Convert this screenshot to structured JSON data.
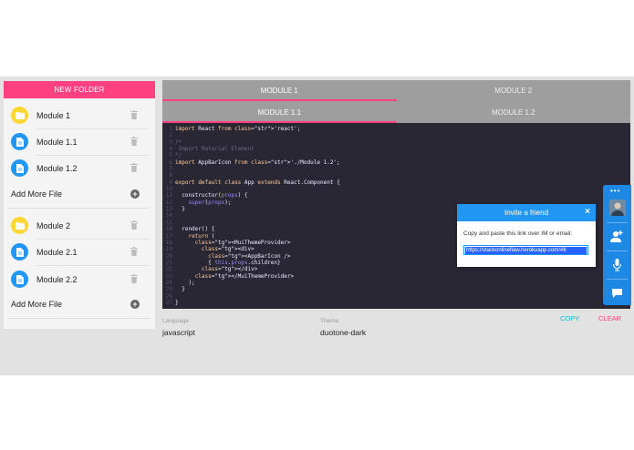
{
  "sidebar": {
    "new_folder_label": "NEW FOLDER",
    "groups": [
      {
        "folder": "Module 1",
        "files": [
          "Module 1.1",
          "Module 1.2"
        ],
        "add_label": "Add More File"
      },
      {
        "folder": "Module 2",
        "files": [
          "Module 2.1",
          "Module 2.2"
        ],
        "add_label": "Add More File"
      }
    ]
  },
  "tabs": {
    "modules": [
      "MODULE 1",
      "MODULE 2"
    ],
    "files": [
      "MODULE 1.1",
      "MODULE 1.2"
    ]
  },
  "editor": {
    "line_numbers": [
      "1",
      "2",
      "3",
      "4",
      "5",
      "6",
      "7",
      "8",
      "9",
      "10",
      "11",
      "12",
      "13",
      "14",
      "15",
      "16",
      "17",
      "18",
      "19",
      "20",
      "21",
      "22",
      "23",
      "24",
      "25",
      "26",
      "27"
    ],
    "lines": [
      "import React from 'react';",
      "",
      "/*",
      " Import Material Element",
      "*/",
      "import AppBarIcon from './Module 1.2';",
      "",
      "",
      "export default class App extends React.Component {",
      "",
      "  constructor(props) {",
      "    super(props);",
      "  }",
      "",
      "",
      "  render() {",
      "    return (",
      "      <MuiThemeProvider>",
      "        <div>",
      "          <AppBarIcon />",
      "          { this.props.children}",
      "        </div>",
      "      </MuiThemeProvider>",
      "    );",
      "  }",
      "",
      "}"
    ]
  },
  "footer": {
    "language_label": "Language",
    "language_value": "javascript",
    "theme_label": "Theme",
    "theme_value": "duotone-dark",
    "copy_label": "COPY",
    "clear_label": "CLEAR"
  },
  "invite": {
    "title": "Invite a friend",
    "close": "×",
    "text": "Copy and paste this link over IM or email:",
    "link": "https://stackonlineflaw.herokuapp.com/#6"
  },
  "widget": {
    "dots": "•••"
  },
  "colors": {
    "accent": "#ff4081",
    "primary": "#2196f3",
    "editor_bg": "#2a2734",
    "tab_bg": "#9e9e9e",
    "folder": "#fdd835",
    "copy": "#00bcd4"
  },
  "icons": [
    "folder-icon",
    "document-icon",
    "trash-icon",
    "add-circle-icon",
    "close-icon",
    "add-person-icon",
    "microphone-icon",
    "chat-icon"
  ]
}
